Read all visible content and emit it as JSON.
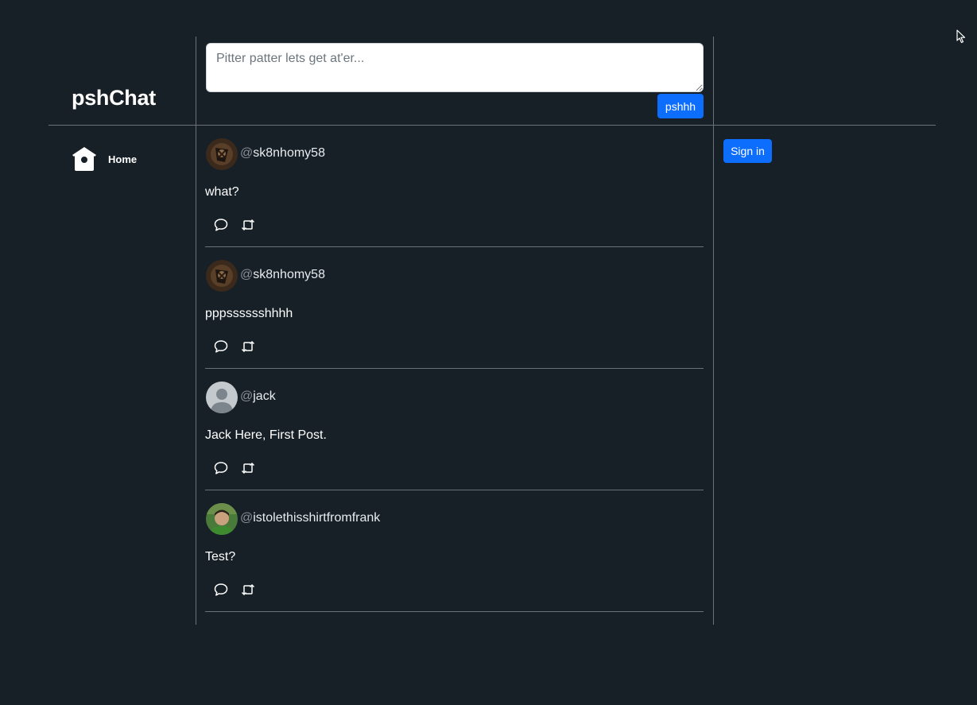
{
  "app": {
    "title": "pshChat"
  },
  "nav": {
    "home_label": "Home"
  },
  "composer": {
    "placeholder": "Pitter patter lets get at'er...",
    "value": "",
    "submit_label": "pshhh"
  },
  "auth": {
    "signin_label": "Sign in"
  },
  "posts": [
    {
      "at": "@",
      "username": "sk8nhomy58",
      "content": "what?"
    },
    {
      "at": "@",
      "username": "sk8nhomy58",
      "content": "pppsssssshhhh"
    },
    {
      "at": "@",
      "username": "jack",
      "content": "Jack Here, First Post."
    },
    {
      "at": "@",
      "username": "istolethisshirtfromfrank",
      "content": "Test?"
    }
  ],
  "colors": {
    "background": "#172027",
    "accent": "#0d6efd",
    "divider": "#6b7178"
  }
}
